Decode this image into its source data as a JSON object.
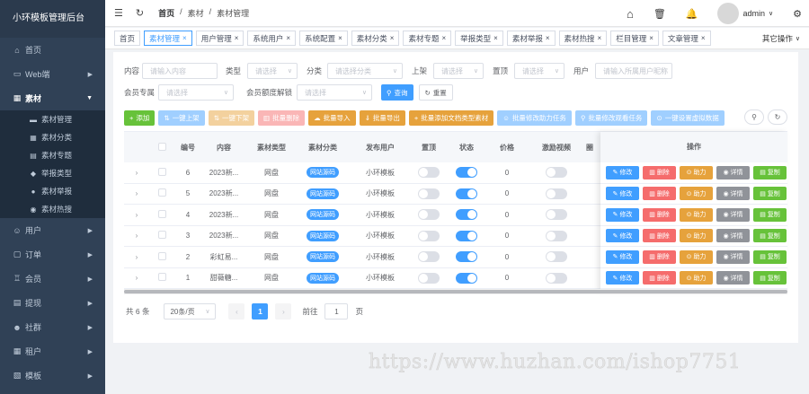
{
  "sidebar": {
    "title": "小环模板管理后台",
    "items": [
      {
        "label": "首页",
        "icon": "home-icon",
        "glyph": "⌂",
        "arrow": false
      },
      {
        "label": "Web端",
        "icon": "monitor-icon",
        "glyph": "▭",
        "arrow": true
      },
      {
        "label": "素材",
        "icon": "material-icon",
        "glyph": "▦",
        "arrow": true,
        "active": true
      }
    ],
    "subitems": [
      {
        "label": "素材管理",
        "glyph": "▬"
      },
      {
        "label": "素材分类",
        "glyph": "▦"
      },
      {
        "label": "素材专题",
        "glyph": "▤"
      },
      {
        "label": "举报类型",
        "glyph": "◆"
      },
      {
        "label": "素材举报",
        "glyph": "●"
      },
      {
        "label": "素材热搜",
        "glyph": "◉"
      }
    ],
    "lower_items": [
      {
        "label": "用户",
        "glyph": "☺"
      },
      {
        "label": "订单",
        "glyph": "▢"
      },
      {
        "label": "会员",
        "glyph": "♖"
      },
      {
        "label": "提现",
        "glyph": "▤"
      },
      {
        "label": "社群",
        "glyph": "☻"
      },
      {
        "label": "租户",
        "glyph": "▦"
      },
      {
        "label": "模板",
        "glyph": "▧"
      }
    ]
  },
  "topbar": {
    "breadcrumb": [
      "首页",
      "/",
      "素材",
      "/",
      "素材管理"
    ],
    "username": "admin"
  },
  "tags": [
    {
      "label": "首页",
      "active": false,
      "closable": false
    },
    {
      "label": "素材管理",
      "active": true,
      "closable": true
    },
    {
      "label": "用户管理",
      "active": false,
      "closable": true
    },
    {
      "label": "系统用户",
      "active": false,
      "closable": true
    },
    {
      "label": "系统配置",
      "active": false,
      "closable": true
    },
    {
      "label": "素材分类",
      "active": false,
      "closable": true
    },
    {
      "label": "素材专题",
      "active": false,
      "closable": true
    },
    {
      "label": "举报类型",
      "active": false,
      "closable": true
    },
    {
      "label": "素材举报",
      "active": false,
      "closable": true
    },
    {
      "label": "素材热搜",
      "active": false,
      "closable": true
    },
    {
      "label": "栏目管理",
      "active": false,
      "closable": true
    },
    {
      "label": "文章管理",
      "active": false,
      "closable": true
    }
  ],
  "other_ops": "其它操作",
  "filters": {
    "content_label": "内容",
    "content_ph": "请输入内容",
    "type_label": "类型",
    "type_ph": "请选择",
    "cat_label": "分类",
    "cat_ph": "请选择分类",
    "up_label": "上架",
    "up_ph": "请选择",
    "top_label": "置顶",
    "top_ph": "请选择",
    "user_label": "用户",
    "user_ph": "请输入所属用户昵称",
    "vip_label": "会员专属",
    "vip_ph": "请选择",
    "unlock_label": "会员额度解锁",
    "unlock_ph": "请选择",
    "search": "查询",
    "reset": "重置"
  },
  "actions": [
    {
      "label": "添加",
      "color": "#67c23a",
      "glyph": "+"
    },
    {
      "label": "一键上架",
      "color": "#a0cfff",
      "glyph": "⇅"
    },
    {
      "label": "一键下架",
      "color": "#f3d19e",
      "glyph": "⇅"
    },
    {
      "label": "批量删除",
      "color": "#fab6b6",
      "glyph": "▥"
    },
    {
      "label": "批量导入",
      "color": "#e6a23c",
      "glyph": "☁"
    },
    {
      "label": "批量导出",
      "color": "#e6a23c",
      "glyph": "⇓"
    },
    {
      "label": "批量添加文档类型素材",
      "color": "#e6a23c",
      "glyph": "+"
    },
    {
      "label": "批量修改助力任务",
      "color": "#a0cfff",
      "glyph": "☺"
    },
    {
      "label": "批量修改观看任务",
      "color": "#a0cfff",
      "glyph": "⚲"
    },
    {
      "label": "一键设置虚拟数据",
      "color": "#a0cfff",
      "glyph": "⊙"
    }
  ],
  "table": {
    "headers": [
      "编号",
      "内容",
      "素材类型",
      "素材分类",
      "发布用户",
      "置顶",
      "状态",
      "价格",
      "激励视频",
      "圈"
    ],
    "ops_header": "操作",
    "rows": [
      {
        "id": "6",
        "content": "2023新...",
        "type": "网盘",
        "category": "网站源码",
        "user": "小环模板",
        "top": false,
        "status": true,
        "price": "0",
        "video": false
      },
      {
        "id": "5",
        "content": "2023新...",
        "type": "网盘",
        "category": "网站源码",
        "user": "小环模板",
        "top": false,
        "status": true,
        "price": "0",
        "video": false
      },
      {
        "id": "4",
        "content": "2023新...",
        "type": "网盘",
        "category": "网站源码",
        "user": "小环模板",
        "top": false,
        "status": true,
        "price": "0",
        "video": false
      },
      {
        "id": "3",
        "content": "2023新...",
        "type": "网盘",
        "category": "网站源码",
        "user": "小环模板",
        "top": false,
        "status": true,
        "price": "0",
        "video": false
      },
      {
        "id": "2",
        "content": "彩虹易...",
        "type": "网盘",
        "category": "网站源码",
        "user": "小环模板",
        "top": false,
        "status": true,
        "price": "0",
        "video": false
      },
      {
        "id": "1",
        "content": "甜薇糖...",
        "type": "网盘",
        "category": "网站源码",
        "user": "小环模板",
        "top": false,
        "status": true,
        "price": "0",
        "video": false
      }
    ],
    "row_ops": [
      {
        "label": "修改",
        "color": "#409eff",
        "glyph": "✎"
      },
      {
        "label": "删除",
        "color": "#f56c6c",
        "glyph": "▥"
      },
      {
        "label": "助力",
        "color": "#e6a23c",
        "glyph": "⊙"
      },
      {
        "label": "详情",
        "color": "#909399",
        "glyph": "◉"
      },
      {
        "label": "复制",
        "color": "#67c23a",
        "glyph": "▤"
      }
    ]
  },
  "pager": {
    "total": "共 6 条",
    "size": "20条/页",
    "page": "1",
    "goto": "前往",
    "goto_val": "1",
    "unit": "页"
  },
  "watermark": "https://www.huzhan.com/ishop7751"
}
